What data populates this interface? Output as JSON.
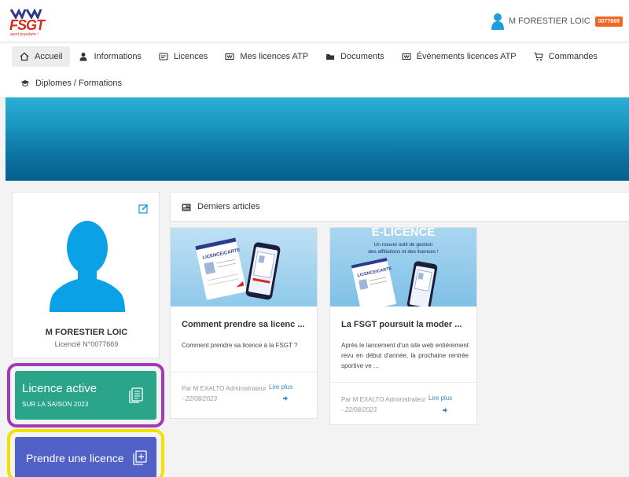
{
  "header": {
    "logo_text": "FSGT",
    "logo_tagline": "sport populaire !",
    "user_name": "M FORESTIER LOIC",
    "user_badge": "0077669"
  },
  "nav": {
    "row1": [
      {
        "label": "Accueil",
        "icon": "home-icon",
        "active": true
      },
      {
        "label": "Informations",
        "icon": "user-icon"
      },
      {
        "label": "Licences",
        "icon": "card-icon"
      },
      {
        "label": "Mes licences ATP",
        "icon": "ticket-icon"
      },
      {
        "label": "Documents",
        "icon": "folder-icon"
      },
      {
        "label": "Évènements licences ATP",
        "icon": "ticket-icon"
      },
      {
        "label": "Commandes",
        "icon": "cart-icon"
      }
    ],
    "row2": [
      {
        "label": "Diplomes / Formations",
        "icon": "graduation-cap-icon"
      }
    ]
  },
  "profile": {
    "name": "M FORESTIER LOIC",
    "licence_number": "Licencié N°0077669"
  },
  "licence_active": {
    "title": "Licence active",
    "subtitle": "SUR LA SAISON 2023",
    "color": "#2aa589",
    "highlight": "#a239b6"
  },
  "take_licence": {
    "label": "Prendre une licence",
    "color": "#5161c8",
    "highlight": "#f5e000"
  },
  "articles": {
    "heading": "Derniers articles",
    "items": [
      {
        "title": "Comment prendre sa licenc ...",
        "excerpt": "Comment prendre sa licence à la FSGT ?",
        "author": "Par M EXALTO Administrateur",
        "date": "- 22/08/2023",
        "more": "Lire plus",
        "image_text": "LICENCE/CARTE"
      },
      {
        "title": "La FSGT poursuit la moder ...",
        "excerpt": "Après le lancement d'un site web entièrement revu en début d'année, la prochaine rentrée sportive ve ...",
        "author": "Par M EXALTO Administrateur",
        "date": "- 22/08/2023",
        "more": "Lire plus",
        "image_headline": "E-LICENCE",
        "image_sub1": "Un nouvel outil de gestion",
        "image_sub2": "des affiliations et des licences !",
        "image_text": "LICENCE/CARTE"
      }
    ]
  },
  "colors": {
    "brand_red": "#d52b1e",
    "badge_orange": "#f26522",
    "link_blue": "#3a89c9",
    "banner": "#1a94c0"
  }
}
